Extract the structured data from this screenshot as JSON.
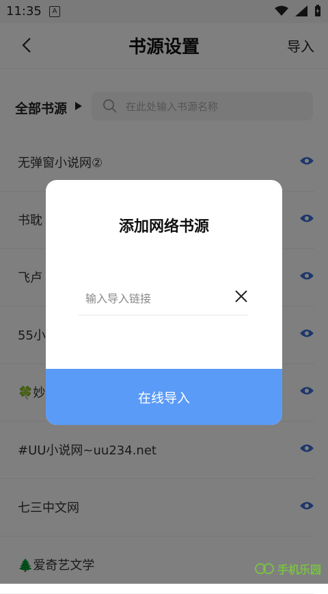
{
  "status": {
    "time": "11:35",
    "notif_icon": "A"
  },
  "header": {
    "title": "书源设置",
    "import": "导入"
  },
  "filter": {
    "label": "全部书源",
    "search_placeholder": "在此处输入书源名称"
  },
  "list": [
    {
      "label": "无弹窗小说网②"
    },
    {
      "label": "书耽"
    },
    {
      "label": "飞卢"
    },
    {
      "label": "55小"
    },
    {
      "label": "🍀妙"
    },
    {
      "label": "#UU小说网~uu234.net"
    },
    {
      "label": "七三中文网"
    },
    {
      "label": "🌲爱奇艺文学"
    }
  ],
  "dialog": {
    "title": "添加网络书源",
    "input_placeholder": "输入导入链接",
    "button": "在线导入"
  },
  "watermark": {
    "text": "手机乐园"
  },
  "colors": {
    "accent": "#5b9bf8",
    "eye": "#3b6fd6"
  }
}
